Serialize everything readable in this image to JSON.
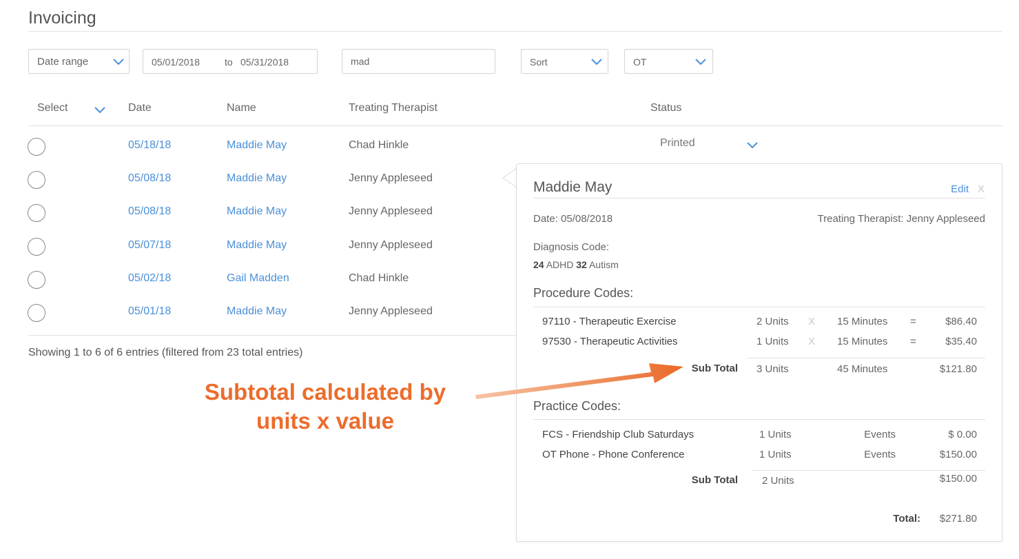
{
  "page": {
    "title": "Invoicing"
  },
  "filters": {
    "date_range_label": "Date range",
    "date_from": "05/01/2018",
    "date_to_label": "to",
    "date_to": "05/31/2018",
    "search_value": "mad",
    "sort_label": "Sort",
    "discipline_value": "OT"
  },
  "table": {
    "columns": {
      "select": "Select",
      "date": "Date",
      "name": "Name",
      "therapist": "Treating Therapist",
      "status": "Status"
    },
    "rows": [
      {
        "date": "05/18/18",
        "name": "Maddie May",
        "therapist": "Chad Hinkle",
        "status": "Printed"
      },
      {
        "date": "05/08/18",
        "name": "Maddie May",
        "therapist": "Jenny Appleseed"
      },
      {
        "date": "05/08/18",
        "name": "Maddie May",
        "therapist": "Jenny Appleseed"
      },
      {
        "date": "05/07/18",
        "name": "Maddie May",
        "therapist": "Jenny Appleseed"
      },
      {
        "date": "05/02/18",
        "name": "Gail Madden",
        "therapist": "Chad Hinkle"
      },
      {
        "date": "05/01/18",
        "name": "Maddie May",
        "therapist": "Jenny Appleseed"
      }
    ],
    "entries_info": "Showing 1 to 6 of 6 entries (filtered from 23 total entries)"
  },
  "detail": {
    "name": "Maddie May",
    "edit_label": "Edit",
    "close_label": "X",
    "date_line": "Date:  05/08/2018",
    "therapist_line": "Treating Therapist: Jenny Appleseed",
    "diagnosis_title": "Diagnosis Code:",
    "diagnosis": [
      {
        "code": "24",
        "label": "ADHD"
      },
      {
        "code": "32",
        "label": "Autism"
      }
    ],
    "procedure_title": "Procedure Codes:",
    "procedures": [
      {
        "desc": "97110 - Therapeutic Exercise",
        "units": "2 Units",
        "x": "X",
        "minutes": "15 Minutes",
        "eq": "=",
        "amount": "$86.40"
      },
      {
        "desc": "97530 - Therapeutic Activities",
        "units": "1 Units",
        "x": "X",
        "minutes": "15 Minutes",
        "eq": "=",
        "amount": "$35.40"
      }
    ],
    "procedure_subtotal": {
      "label": "Sub Total",
      "units": "3 Units",
      "minutes": "45 Minutes",
      "amount": "$121.80"
    },
    "practice_title": "Practice Codes:",
    "practices": [
      {
        "desc": "FCS - Friendship Club Saturdays",
        "units": "1  Units",
        "type": "Events",
        "amount": "$ 0.00"
      },
      {
        "desc": "OT Phone - Phone Conference",
        "units": "1  Units",
        "type": "Events",
        "amount": "$150.00"
      }
    ],
    "practice_subtotal": {
      "label": "Sub Total",
      "units": "2 Units",
      "amount": "$150.00"
    },
    "total": {
      "label": "Total:",
      "amount": "$271.80"
    }
  },
  "annotation": {
    "line1": "Subtotal calculated by",
    "line2": "units x value",
    "color": "#ec6c2c"
  },
  "colors": {
    "link": "#4a90d9",
    "accent": "#ec6c2c"
  }
}
